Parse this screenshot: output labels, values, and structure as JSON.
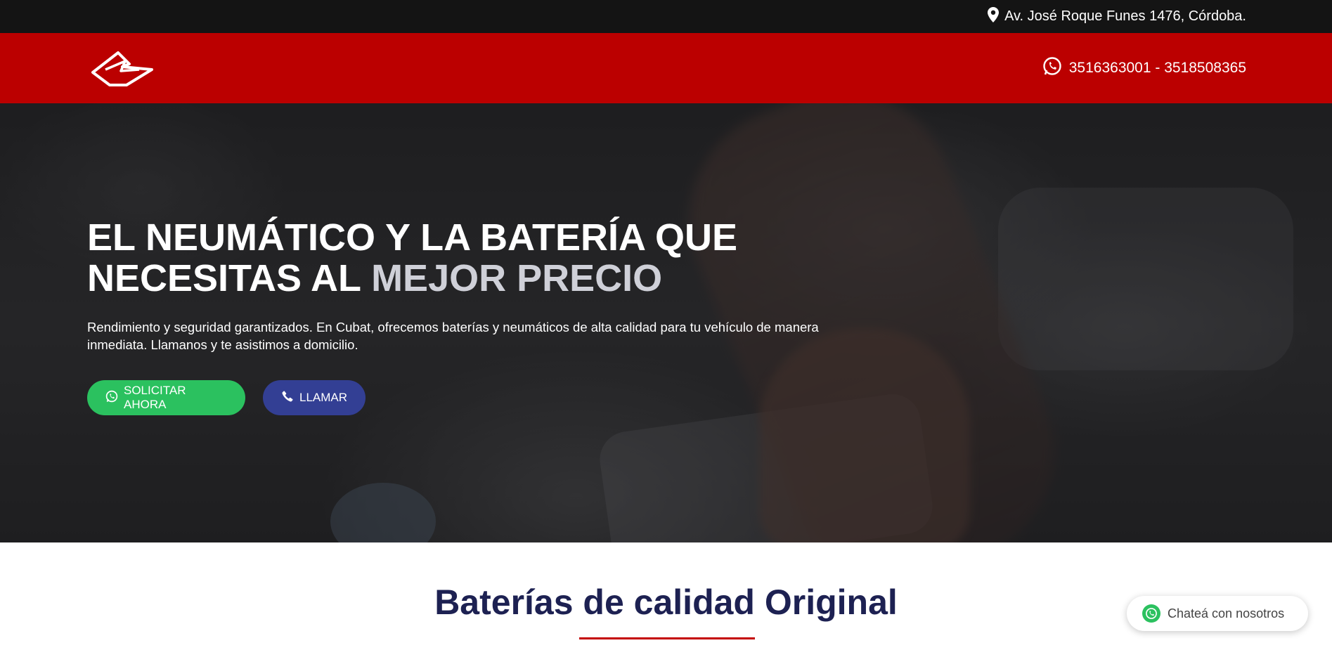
{
  "topbar": {
    "address": "Av. José Roque Funes 1476, Córdoba.",
    "address_icon": "map-pin-icon"
  },
  "header": {
    "logo_icon": "cubat-logo",
    "phone_icon": "whatsapp-icon",
    "phones": "3516363001 - 3518508365"
  },
  "hero": {
    "title_line1": "EL NEUMÁTICO Y LA BATERÍA QUE",
    "title_line2_prefix": "NECESITAS AL",
    "title_line2_accent": "MEJOR PRECIO",
    "subtitle": "Rendimiento y seguridad garantizados. En Cubat, ofrecemos baterías y neumáticos de alta calidad para tu vehículo de manera inmediata. Llamanos y te asistimos a domicilio.",
    "buttons": [
      {
        "label": "SOLICITAR AHORA",
        "icon": "whatsapp-icon",
        "color": "#2bc15f"
      },
      {
        "label": "LLAMAR",
        "icon": "phone-icon",
        "color": "#333f94"
      }
    ]
  },
  "section": {
    "title": "Baterías de calidad Original",
    "underline_color": "#c40000"
  },
  "chat_widget": {
    "label": "Chateá con nosotros",
    "icon": "whatsapp-icon"
  },
  "colors": {
    "header_red": "#bb0000",
    "topbar": "#141414",
    "title_navy": "#1d2152"
  }
}
